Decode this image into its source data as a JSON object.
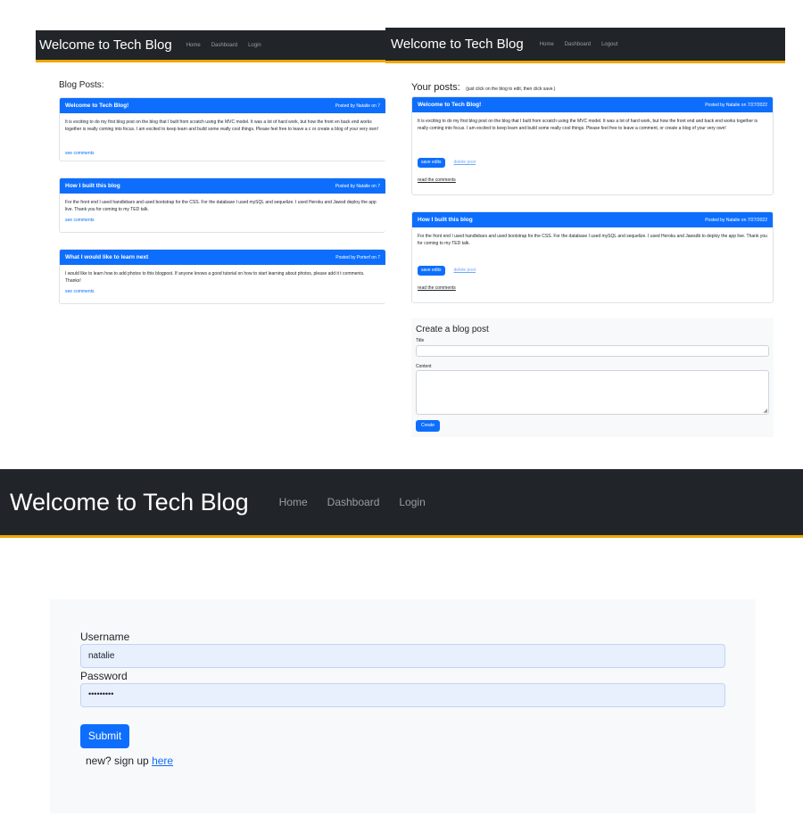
{
  "left_panel": {
    "nav": {
      "brand": "Welcome to Tech Blog",
      "links": [
        "Home",
        "Dashboard",
        "Login"
      ]
    },
    "heading": "Blog Posts:",
    "posts": [
      {
        "title": "Welcome to Tech Blog!",
        "byline": "Posted by Natalie on 7",
        "body": "It is exciting to do my first blog post on the blog that I built from scratch using the MVC model. It was a lot of hard work, but how the front en back end works together is really coming into focus. I am excited to keep learn and build some really cool things. Please feel free to leave a c or create a blog of your very own!",
        "link": "see comments"
      },
      {
        "title": "How I built this blog",
        "byline": "Posted by Natalie on 7",
        "body": "For the front end I used handlebars and used bootstrap for the CSS. For the database I used mySQL and sequelize. I used Heroku and Jawsd deploy the app live. Thank you for coming to my TED talk.",
        "link": "see comments"
      },
      {
        "title": "What I would like to learn next",
        "byline": "Posted by Porterf on 7",
        "body": "I would like to learn how to add photos to this blogpost. If anyone knows a good tutorial on how to start learning about photos, please add it t comments. Thanks!",
        "link": "see comments"
      }
    ]
  },
  "right_panel": {
    "nav": {
      "brand": "Welcome to Tech Blog",
      "links": [
        "Home",
        "Dashboard",
        "Logout"
      ]
    },
    "heading": "Your posts:",
    "subheading": "(just click on the blog to edit, then click save.)",
    "posts": [
      {
        "title": "Welcome to Tech Blog!",
        "byline": "Posted by Natalie on 7/27/2022",
        "body": "It is exciting to do my first blog post on the blog that I built from scratch using the MVC model. It was a lot of hard work, but how the front end and back end works together is really coming into focus. I am excited to keep learn and build some really cool things. Please feel free to leave a comment, or create a blog of your very own!",
        "save_label": "save edits",
        "delete_label": "delete post",
        "comments_label": "read the comments"
      },
      {
        "title": "How I built this blog",
        "byline": "Posted by Natalie on 7/27/2022",
        "body": "For the front end I used handlebars and used bootstrap for the CSS. For the database I used mySQL and sequelize. I used Heroku and Jawsdb to deploy the app live. Thank you for coming to my TED talk.",
        "save_label": "save edits",
        "delete_label": "delete post",
        "comments_label": "read the comments"
      }
    ],
    "create": {
      "heading": "Create a blog post",
      "title_label": "Title",
      "content_label": "Content",
      "button": "Create"
    }
  },
  "login_page": {
    "nav": {
      "brand": "Welcome to Tech Blog",
      "links": [
        "Home",
        "Dashboard",
        "Login"
      ]
    },
    "username_label": "Username",
    "username_value": "natalie",
    "password_label": "Password",
    "password_value": "•••••••••",
    "submit_label": "Submit",
    "signup_text": "new? sign up",
    "signup_link": "here"
  },
  "colors": {
    "navbar": "#212529",
    "accent_border": "#f0a500",
    "primary": "#0d6efd",
    "panel_bg": "#f8f9fa"
  }
}
